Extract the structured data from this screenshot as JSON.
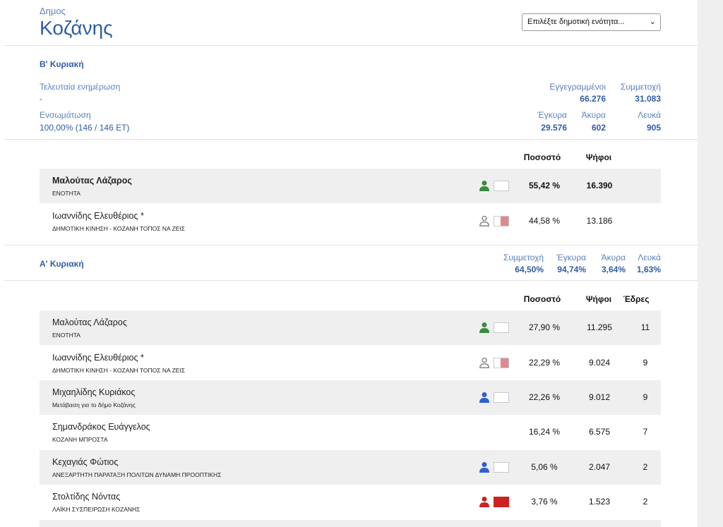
{
  "header": {
    "small": "Δημος",
    "title": "Κοζάνης",
    "select_value": "Επιλέξτε δημοτική ενότητα..."
  },
  "round_b": {
    "title": "Β' Κυριακή",
    "last_update_label": "Τελευταία ενημέρωση",
    "last_update_value": "-",
    "integration_label": "Ενσωμάτωση",
    "integration_value": "100,00% (146 / 146 ΕΤ)",
    "registered_label": "Εγγεγραμμένοι",
    "registered_value": "66.276",
    "turnout_label": "Συμμετοχή",
    "turnout_value": "31.083",
    "valid_label": "Έγκυρα",
    "valid_value": "29.576",
    "invalid_label": "Άκυρα",
    "invalid_value": "602",
    "blank_label": "Λευκά",
    "blank_value": "905",
    "col_percent": "Ποσοστό",
    "col_votes": "Ψήφοι",
    "rows": [
      {
        "name": "Μαλούτας Λάζαρος",
        "party": "ΕΝΟΤΗΤΑ",
        "percent": "55,42 %",
        "votes": "16.390",
        "icon": "person-green-icon",
        "color": "#3b8a3e",
        "swatch": "#ffffff"
      },
      {
        "name": "Ιωαννίδης Ελευθέριος *",
        "party": "ΔΗΜΟΤΙΚΗ ΚΙΝΗΣΗ - ΚΟΖΑΝΗ ΤΟΠΟΣ ΝΑ ΖΕΙΣ",
        "percent": "44,58 %",
        "votes": "13.186",
        "icon": "person-outline-icon",
        "color": "#8a8a8a",
        "swatch": "#e0888f"
      }
    ]
  },
  "round_a": {
    "title": "Α' Κυριακή",
    "turnout_label": "Συμμετοχή",
    "turnout_value": "64,50%",
    "valid_label": "Έγκυρα",
    "valid_value": "94,74%",
    "invalid_label": "Άκυρα",
    "invalid_value": "3,64%",
    "blank_label": "Λευκά",
    "blank_value": "1,63%",
    "col_percent": "Ποσοστό",
    "col_votes": "Ψήφοι",
    "col_seats": "Έδρες",
    "rows": [
      {
        "name": "Μαλούτας Λάζαρος",
        "party": "ΕΝΟΤΗΤΑ",
        "percent": "27,90 %",
        "votes": "11.295",
        "seats": "11",
        "icon": "person-green-icon",
        "color": "#3b8a3e"
      },
      {
        "name": "Ιωαννίδης Ελευθέριος *",
        "party": "ΔΗΜΟΤΙΚΗ ΚΙΝΗΣΗ - ΚΟΖΑΝΗ ΤΟΠΟΣ ΝΑ ΖΕΙΣ",
        "percent": "22,29 %",
        "votes": "9.024",
        "seats": "9",
        "icon": "person-outline-icon",
        "color": "#8a8a8a"
      },
      {
        "name": "Μιχαηλίδης Κυριάκος",
        "party": "Μετάβαση για το δήμο Κοζάνης",
        "percent": "22,26 %",
        "votes": "9.012",
        "seats": "9",
        "icon": "person-blue-icon",
        "color": "#2f5fd0"
      },
      {
        "name": "Σημανδράκος Ευάγγελος",
        "party": "ΚΟΖΑΝΗ ΜΠΡΟΣΤΑ",
        "percent": "16,24 %",
        "votes": "6.575",
        "seats": "7"
      },
      {
        "name": "Κεχαγιάς Φώτιος",
        "party": "ΑΝΕΞΑΡΤΗΤΗ ΠΑΡΑΤΑΞΗ ΠΟΛΙΤΩΝ ΔΥΝΑΜΗ ΠΡΟΟΠΤΙΚΗΣ",
        "percent": "5,06 %",
        "votes": "2.047",
        "seats": "2",
        "icon": "person-blue-icon",
        "color": "#2f5fd0"
      },
      {
        "name": "Στολτίδης Νόντας",
        "party": "ΛΑΪΚΗ ΣΥΣΠΕΙΡΩΣΗ ΚΟΖΑΝΗΣ",
        "percent": "3,76 %",
        "votes": "1.523",
        "seats": "2",
        "icon": "person-red-icon",
        "color": "#cc2222"
      }
    ]
  }
}
